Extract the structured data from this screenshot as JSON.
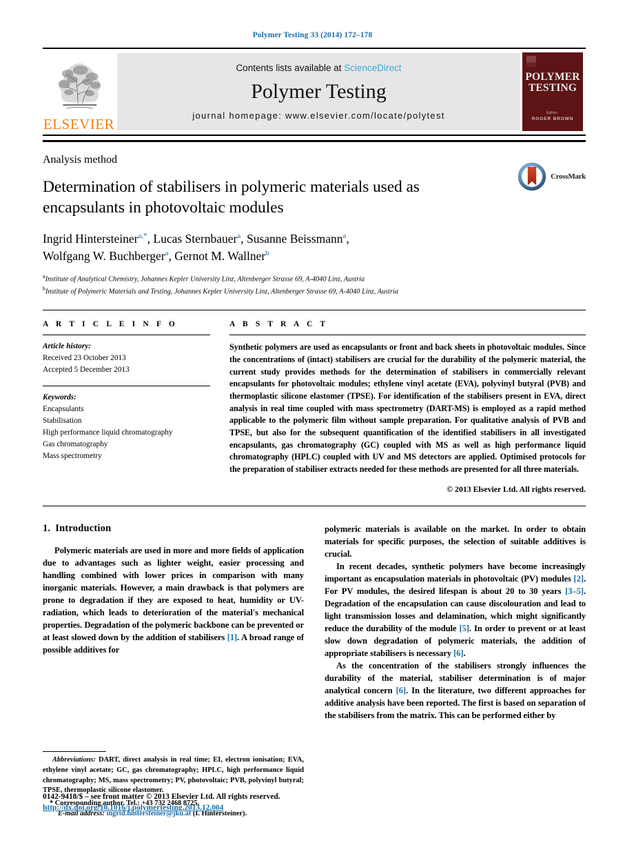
{
  "running_head": "Polymer Testing 33 (2014) 172–178",
  "masthead": {
    "contents_prefix": "Contents lists available at ",
    "sciencedirect": "ScienceDirect",
    "journal_name": "Polymer Testing",
    "homepage": "journal homepage: www.elsevier.com/locate/polytest",
    "publisher_logo_text": "ELSEVIER",
    "cover": {
      "title_line1": "POLYMER",
      "title_line2": "TESTING",
      "editor_label": "Editor:",
      "editor_name": "ROGER BROWN"
    }
  },
  "article": {
    "section_kind": "Analysis method",
    "title": "Determination of stabilisers in polymeric materials used as encapsulants in photovoltaic modules",
    "crossmark_label": "CrossMark",
    "authors_line1_pre": "Ingrid Hintersteiner",
    "authors": [
      {
        "name": "Ingrid Hintersteiner",
        "sup": "a",
        "star": true
      },
      {
        "name": "Lucas Sternbauer",
        "sup": "a",
        "star": false
      },
      {
        "name": "Susanne Beissmann",
        "sup": "a",
        "star": false
      },
      {
        "name": "Wolfgang W. Buchberger",
        "sup": "a",
        "star": false
      },
      {
        "name": "Gernot M. Wallner",
        "sup": "b",
        "star": false
      }
    ],
    "affiliations": [
      {
        "marker": "a",
        "text": "Institute of Analytical Chemistry, Johannes Kepler University Linz, Altenberger Strasse 69, A-4040 Linz, Austria"
      },
      {
        "marker": "b",
        "text": "Institute of Polymeric Materials and Testing, Johannes Kepler University Linz, Altenberger Strasse 69, A-4040 Linz, Austria"
      }
    ]
  },
  "article_info": {
    "heading": "A R T I C L E  I N F O",
    "history_label": "Article history:",
    "received": "Received 23 October 2013",
    "accepted": "Accepted 5 December 2013",
    "keywords_label": "Keywords:",
    "keywords": [
      "Encapsulants",
      "Stabilisation",
      "High performance liquid chromatography",
      "Gas chromatography",
      "Mass spectrometry"
    ]
  },
  "abstract": {
    "heading": "A B S T R A C T",
    "text": "Synthetic polymers are used as encapsulants or front and back sheets in photovoltaic modules. Since the concentrations of (intact) stabilisers are crucial for the durability of the polymeric material, the current study provides methods for the determination of stabilisers in commercially relevant encapsulants for photovoltaic modules; ethylene vinyl acetate (EVA), polyvinyl butyral (PVB) and thermoplastic silicone elastomer (TPSE). For identification of the stabilisers present in EVA, direct analysis in real time coupled with mass spectrometry (DART-MS) is employed as a rapid method applicable to the polymeric film without sample preparation. For qualitative analysis of PVB and TPSE, but also for the subsequent quantification of the identified stabilisers in all investigated encapsulants, gas chromatography (GC) coupled with MS as well as high performance liquid chromatography (HPLC) coupled with UV and MS detectors are applied. Optimised protocols for the preparation of stabiliser extracts needed for these methods are presented for all three materials.",
    "copyright": "© 2013 Elsevier Ltd. All rights reserved."
  },
  "intro": {
    "heading_num": "1.",
    "heading_text": "Introduction",
    "left_para_1": "Polymeric materials are used in more and more fields of application due to advantages such as lighter weight, easier processing and handling combined with lower prices in comparison with many inorganic materials. However, a main drawback is that polymers are prone to degradation if they are exposed to heat, humidity or UV-radiation, which leads to deterioration of the material's mechanical properties. Degradation of the polymeric backbone can be prevented or at least slowed down by the addition of stabilisers ",
    "left_ref_1": "[1]",
    "left_para_1b": ". A broad range of possible additives for",
    "right_para_1": "polymeric materials is available on the market. In order to obtain materials for specific purposes, the selection of suitable additives is crucial.",
    "right_para_2a": "In recent decades, synthetic polymers have become increasingly important as encapsulation materials in photovoltaic (PV) modules ",
    "right_ref_2": "[2]",
    "right_para_2b": ". For PV modules, the desired lifespan is about 20 to 30 years ",
    "right_ref_3": "[3–5]",
    "right_para_2c": ". Degradation of the encapsulation can cause discolouration and lead to light transmission losses and delamination, which might significantly reduce the durability of the module ",
    "right_ref_4": "[5]",
    "right_para_2d": ". In order to prevent or at least slow down degradation of polymeric materials, the addition of appropriate stabilisers is necessary ",
    "right_ref_5": "[6]",
    "right_para_2e": ".",
    "right_para_3a": "As the concentration of the stabilisers strongly influences the durability of the material, stabiliser determination is of major analytical concern ",
    "right_ref_6": "[6]",
    "right_para_3b": ". In the literature, two different approaches for additive analysis have been reported. The first is based on separation of the stabilisers from the matrix. This can be performed either by"
  },
  "footnotes": {
    "abbrev_label": "Abbreviations:",
    "abbrev_text": " DART, direct analysis in real time; EI, electron ionisation; EVA, ethylene vinyl acetate; GC, gas chromatography; HPLC, high performance liquid chromatography; MS, mass spectrometry; PV, photovoltaic; PVB, polyvinyl butyral; TPSE, thermoplastic silicone elastomer.",
    "corresponding": "* Corresponding author. Tel.: +43 732 2468 8725.",
    "email_label": "E-mail address:",
    "email": "ingrid.hintersteiner@jku.at",
    "email_suffix": " (I. Hintersteiner)."
  },
  "page_footer": {
    "issn_line": "0142-9418/$ – see front matter © 2013 Elsevier Ltd. All rights reserved.",
    "doi": "http://dx.doi.org/10.1016/j.polymertesting.2013.12.004"
  },
  "colors": {
    "link": "#1a6ea8",
    "sciencedirect": "#3aa9e0",
    "elsevier_orange": "#F07F13",
    "cover_maroon": "#5e1414",
    "band_grey": "#e6e6e6"
  }
}
